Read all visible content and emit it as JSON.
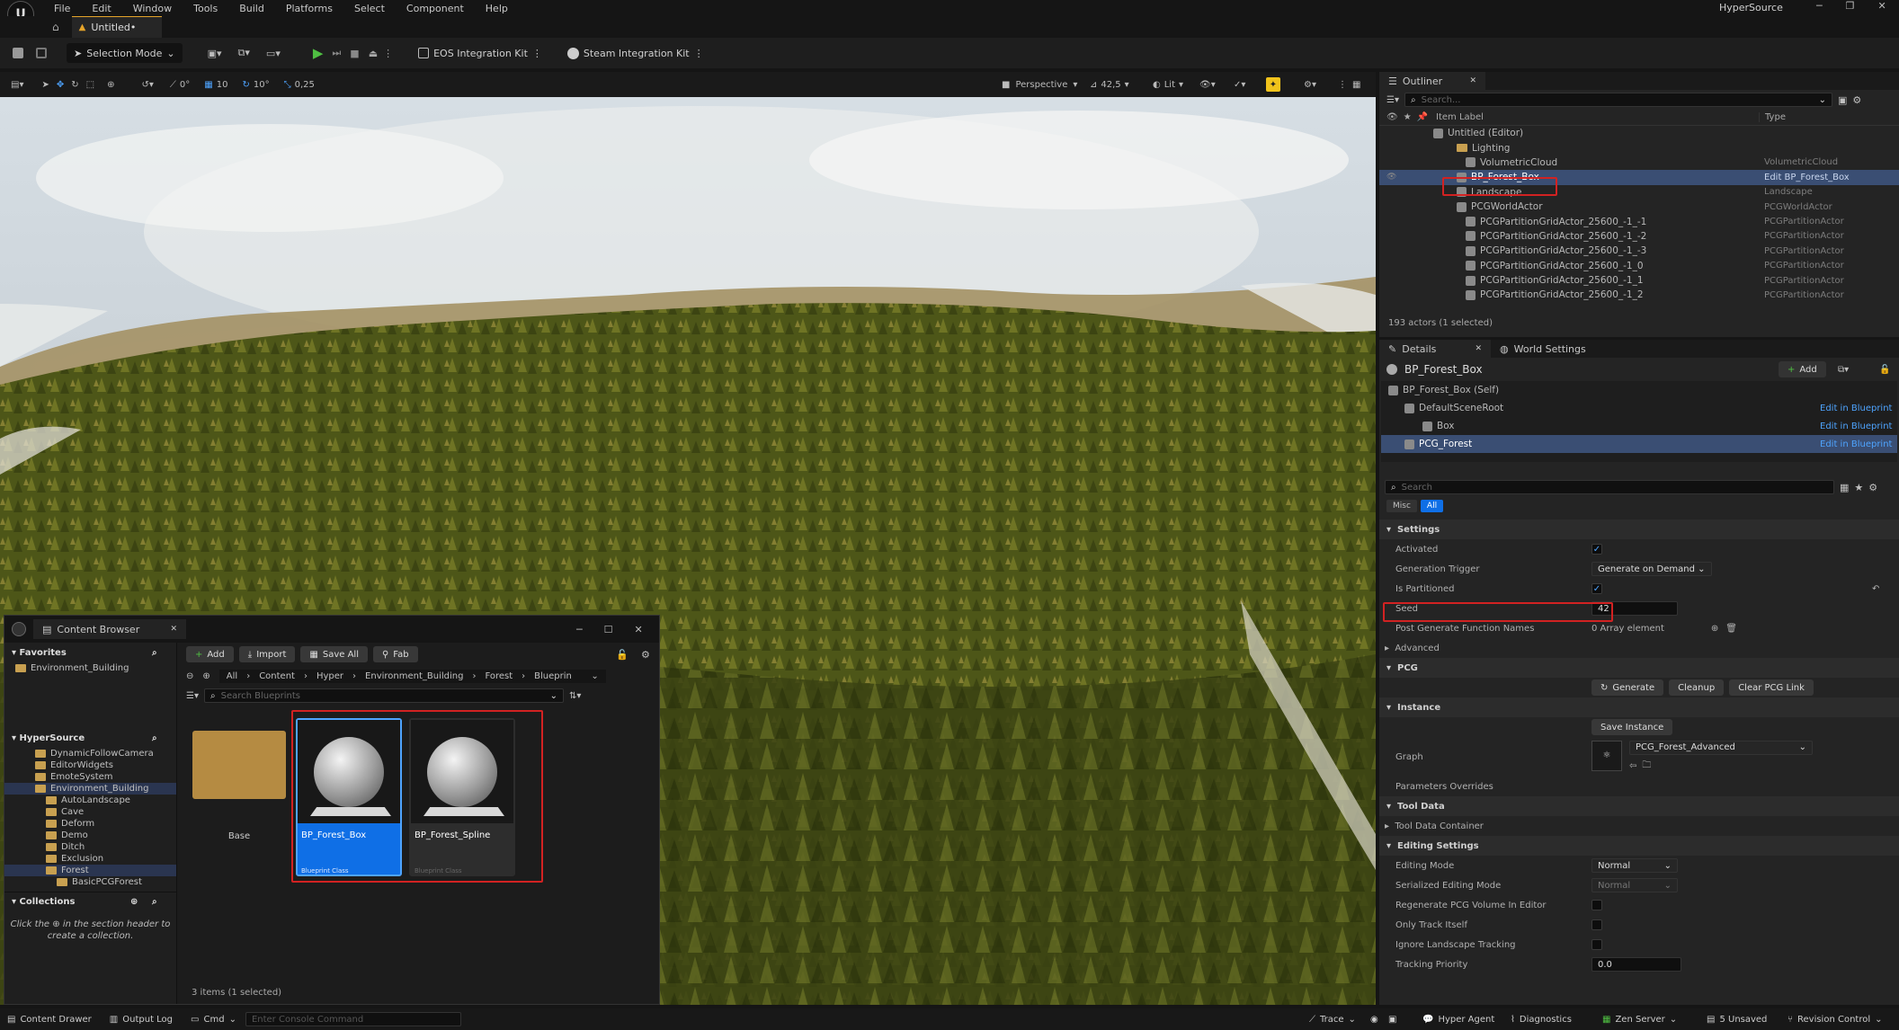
{
  "menu": [
    "File",
    "Edit",
    "Window",
    "Tools",
    "Build",
    "Platforms",
    "Select",
    "Component",
    "Help"
  ],
  "project_name": "HyperSource",
  "level_tab": "Untitled•",
  "toolbar": {
    "selection_mode": "Selection Mode",
    "eos_kit": "EOS Integration Kit",
    "steam_kit": "Steam Integration Kit"
  },
  "viewport_toolbar": {
    "rot_snap": "0°",
    "grid_snap": "10",
    "angle_snap": "10°",
    "scale_snap": "0,25",
    "view_mode": "Perspective",
    "fov": "42,5",
    "lit": "Lit"
  },
  "outliner": {
    "tab": "Outliner",
    "search_placeholder": "Search...",
    "col_label": "Item Label",
    "col_type": "Type",
    "rows": [
      {
        "label": "Untitled (Editor)",
        "type": "",
        "indent": 60,
        "kind": "world"
      },
      {
        "label": "Lighting",
        "type": "",
        "indent": 86,
        "kind": "folder"
      },
      {
        "label": "VolumetricCloud",
        "type": "VolumetricCloud",
        "indent": 96,
        "kind": "actor"
      },
      {
        "label": "BP_Forest_Box",
        "type": "Edit BP_Forest_Box",
        "indent": 86,
        "kind": "actor",
        "selected": true
      },
      {
        "label": "Landscape",
        "type": "Landscape",
        "indent": 86,
        "kind": "actor"
      },
      {
        "label": "PCGWorldActor",
        "type": "PCGWorldActor",
        "indent": 86,
        "kind": "actor"
      },
      {
        "label": "PCGPartitionGridActor_25600_-1_-1",
        "type": "PCGPartitionActor",
        "indent": 96,
        "kind": "actor"
      },
      {
        "label": "PCGPartitionGridActor_25600_-1_-2",
        "type": "PCGPartitionActor",
        "indent": 96,
        "kind": "actor"
      },
      {
        "label": "PCGPartitionGridActor_25600_-1_-3",
        "type": "PCGPartitionActor",
        "indent": 96,
        "kind": "actor"
      },
      {
        "label": "PCGPartitionGridActor_25600_-1_0",
        "type": "PCGPartitionActor",
        "indent": 96,
        "kind": "actor"
      },
      {
        "label": "PCGPartitionGridActor_25600_-1_1",
        "type": "PCGPartitionActor",
        "indent": 96,
        "kind": "actor"
      },
      {
        "label": "PCGPartitionGridActor_25600_-1_2",
        "type": "PCGPartitionActor",
        "indent": 96,
        "kind": "actor"
      }
    ],
    "status": "193 actors (1 selected)"
  },
  "details": {
    "tab": "Details",
    "tab2": "World Settings",
    "title": "BP_Forest_Box",
    "add": "Add",
    "components": [
      {
        "label": "BP_Forest_Box (Self)",
        "indent": 8,
        "link": ""
      },
      {
        "label": "DefaultSceneRoot",
        "indent": 26,
        "link": "Edit in Blueprint"
      },
      {
        "label": "Box",
        "indent": 46,
        "link": "Edit in Blueprint"
      },
      {
        "label": "PCG_Forest",
        "indent": 26,
        "link": "Edit in Blueprint",
        "selected": true
      }
    ],
    "search_placeholder": "Search",
    "filter_misc": "Misc",
    "filter_all": "All",
    "settings": {
      "section": "Settings",
      "activated": "Activated",
      "gen_trigger": "Generation Trigger",
      "gen_trigger_val": "Generate on Demand",
      "is_partitioned": "Is Partitioned",
      "seed": "Seed",
      "seed_val": "42",
      "post_gen": "Post Generate Function Names",
      "post_gen_val": "0 Array element",
      "advanced": "Advanced"
    },
    "pcg": {
      "section": "PCG",
      "generate": "Generate",
      "cleanup": "Cleanup",
      "clear_link": "Clear PCG Link"
    },
    "instance": {
      "section": "Instance",
      "save_instance": "Save Instance",
      "graph": "Graph",
      "graph_val": "PCG_Forest_Advanced",
      "param_overrides": "Parameters Overrides"
    },
    "tool_data": {
      "section": "Tool Data",
      "container": "Tool Data Container"
    },
    "editing": {
      "section": "Editing Settings",
      "mode": "Editing Mode",
      "mode_val": "Normal",
      "serialized": "Serialized Editing Mode",
      "serialized_val": "Normal",
      "regen": "Regenerate PCG Volume In Editor",
      "only_track": "Only Track Itself",
      "ignore_landscape": "Ignore Landscape Tracking",
      "priority": "Tracking Priority",
      "priority_val": "0.0"
    }
  },
  "content_browser": {
    "title": "Content Browser",
    "add": "Add",
    "import": "Import",
    "save_all": "Save All",
    "fab": "Fab",
    "path": [
      "All",
      "Content",
      "Hyper",
      "Environment_Building",
      "Forest",
      "Blueprin"
    ],
    "search_placeholder": "Search Blueprints",
    "favorites": "Favorites",
    "fav_item": "Environment_Building",
    "source": "HyperSource",
    "tree": [
      "DynamicFollowCamera",
      "EditorWidgets",
      "EmoteSystem",
      "Environment_Building",
      "AutoLandscape",
      "Cave",
      "Deform",
      "Demo",
      "Ditch",
      "Exclusion",
      "Forest",
      "BasicPCGForest"
    ],
    "collections": "Collections",
    "collections_hint_a": "Click the",
    "collections_hint_b": "in the section header to",
    "collections_hint_c": "create a collection.",
    "assets": [
      {
        "name": "Base",
        "kind": "folder"
      },
      {
        "name": "BP_Forest_Box",
        "sub": "Blueprint Class",
        "kind": "bp",
        "selected": true
      },
      {
        "name": "BP_Forest_Spline",
        "sub": "Blueprint Class",
        "kind": "bp"
      }
    ],
    "status": "3 items (1 selected)"
  },
  "statusbar": {
    "drawer": "Content Drawer",
    "output": "Output Log",
    "cmd": "Cmd",
    "console_placeholder": "Enter Console Command",
    "trace": "Trace",
    "hyper_agent": "Hyper Agent",
    "diagnostics": "Diagnostics",
    "zen": "Zen Server",
    "unsaved": "5 Unsaved",
    "revision": "Revision Control"
  }
}
